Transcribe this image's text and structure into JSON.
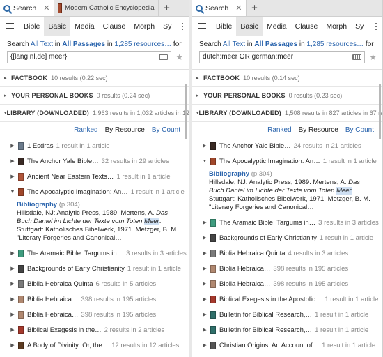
{
  "left": {
    "tabs": [
      {
        "label": "Search",
        "icon": "search-icon",
        "closable": true
      },
      {
        "label": "Modern Catholic Encyclopedia",
        "icon": "book-icon",
        "closable": false
      }
    ],
    "add_tab": "+",
    "kinds": [
      "Bible",
      "Basic",
      "Media",
      "Clause",
      "Morph",
      "Sy"
    ],
    "active_kind": "Basic",
    "scope": {
      "prefix": "Search",
      "all_text": "All Text",
      "in1": "in",
      "passages": "All Passages",
      "in2": "in",
      "resources": "1,285 resources…",
      "for": "for"
    },
    "query": "{[lang nl,de] meer}",
    "sections": [
      {
        "tri": "▸",
        "name": "FACTBOOK",
        "count": "10 results (0.22 sec)"
      },
      {
        "tri": "▸",
        "name": "YOUR PERSONAL BOOKS",
        "count": "0 results (0.24 sec)"
      },
      {
        "tri": "▾",
        "name": "LIBRARY (DOWNLOADED)",
        "count": "1,963 results in 1,032 articles in 125"
      }
    ],
    "sort": {
      "ranked": "Ranked",
      "by_resource": "By Resource",
      "by_count": "By Count"
    },
    "results_before": [
      {
        "title": "1 Esdras",
        "meta": "1 result in 1 article",
        "color": "#6b7b8c"
      },
      {
        "title": "The Anchor Yale Bible…",
        "meta": "32 results in 29 articles",
        "color": "#3a2a24"
      },
      {
        "title": "Ancient Near Eastern Texts…",
        "meta": "1 result in 1 article",
        "color": "#b0553a"
      },
      {
        "title": "The Apocalyptic Imagination: An…",
        "meta": "1 result in 1 article",
        "color": "#a0472a",
        "expanded": true
      }
    ],
    "bib": {
      "head": "Bibliography",
      "page": "(p 304)",
      "line1": "Hillsdale, NJ: Analytic Press, 1989. Mertens, A. ",
      "line1_italic": "Das Buch Daniel im Lichte der Texte vom Toten ",
      "hit": "Meer",
      "line2": ". Stuttgart: Katholisches Bibelwerk, 1971. Metzger, B. M. \"Literary Forgeries and Canonical…"
    },
    "results_after": [
      {
        "title": "The Aramaic Bible: Targums in…",
        "meta": "3 results in 3 articles",
        "color": "#3f9c7f"
      },
      {
        "title": "Backgrounds of Early Christianity",
        "meta": "1 result in 1 article",
        "color": "#444"
      },
      {
        "title": "Biblia Hebraica Quinta",
        "meta": "6 results in 5 articles",
        "color": "#7a7a7a"
      },
      {
        "title": "Biblia Hebraica…",
        "meta": "398 results in 195 articles",
        "color": "#b08870"
      },
      {
        "title": "Biblia Hebraica…",
        "meta": "398 results in 195 articles",
        "color": "#b08870"
      },
      {
        "title": "Biblical Exegesis in the…",
        "meta": "2 results in 2 articles",
        "color": "#a5392c"
      },
      {
        "title": "A Body of Divinity: Or, the…",
        "meta": "12 results in 12 articles",
        "color": "#5c3b22"
      }
    ]
  },
  "right": {
    "tabs": [
      {
        "label": "Search",
        "icon": "search-icon",
        "closable": true
      }
    ],
    "add_tab": "+",
    "kinds": [
      "Bible",
      "Basic",
      "Media",
      "Clause",
      "Morph",
      "Sy"
    ],
    "active_kind": "Basic",
    "scope": {
      "prefix": "Search",
      "all_text": "All Text",
      "in1": "in",
      "passages": "All Passages",
      "in2": "in",
      "resources": "1,285 resources…",
      "for": "for"
    },
    "query": "dutch:meer OR german:meer",
    "sections": [
      {
        "tri": "▸",
        "name": "FACTBOOK",
        "count": "10 results (0.14 sec)"
      },
      {
        "tri": "▸",
        "name": "YOUR PERSONAL BOOKS",
        "count": "0 results (0.23 sec)"
      },
      {
        "tri": "▾",
        "name": "LIBRARY (DOWNLOADED)",
        "count": "1,508 results in 827 articles in 67 res"
      }
    ],
    "sort": {
      "ranked": "Ranked",
      "by_resource": "By Resource",
      "by_count": "By Count"
    },
    "results_before": [
      {
        "title": "The Anchor Yale Bible…",
        "meta": "24 results in 21 articles",
        "color": "#3a2a24"
      },
      {
        "title": "The Apocalyptic Imagination: An…",
        "meta": "1 result in 1 article",
        "color": "#a0472a",
        "expanded": true
      }
    ],
    "bib": {
      "head": "Bibliography",
      "page": "(p 304)",
      "line1": "Hillsdale, NJ: Analytic Press, 1989. Mertens, A. ",
      "line1_italic": "Das Buch Daniel im Lichte der Texte vom Toten ",
      "hit": "Meer",
      "line2": ". Stuttgart: Katholisches Bibelwerk, 1971. Metzger, B. M. \"Literary Forgeries and Canonical…"
    },
    "results_after": [
      {
        "title": "The Aramaic Bible: Targums in…",
        "meta": "3 results in 3 articles",
        "color": "#3f9c7f"
      },
      {
        "title": "Backgrounds of Early Christianity",
        "meta": "1 result in 1 article",
        "color": "#444"
      },
      {
        "title": "Biblia Hebraica Quinta",
        "meta": "4 results in 3 articles",
        "color": "#7a7a7a"
      },
      {
        "title": "Biblia Hebraica…",
        "meta": "398 results in 195 articles",
        "color": "#b08870"
      },
      {
        "title": "Biblia Hebraica…",
        "meta": "398 results in 195 articles",
        "color": "#b08870"
      },
      {
        "title": "Biblical Exegesis in the Apostolic…",
        "meta": "1 result in 1 article",
        "color": "#a5392c"
      },
      {
        "title": "Bulletin for Biblical Research,…",
        "meta": "1 result in 1 article",
        "color": "#2f6f6a"
      },
      {
        "title": "Bulletin for Biblical Research,…",
        "meta": "1 result in 1 article",
        "color": "#2f6f6a"
      },
      {
        "title": "Christian Origins: An Account of…",
        "meta": "1 result in 1 article",
        "color": "#555"
      }
    ]
  }
}
